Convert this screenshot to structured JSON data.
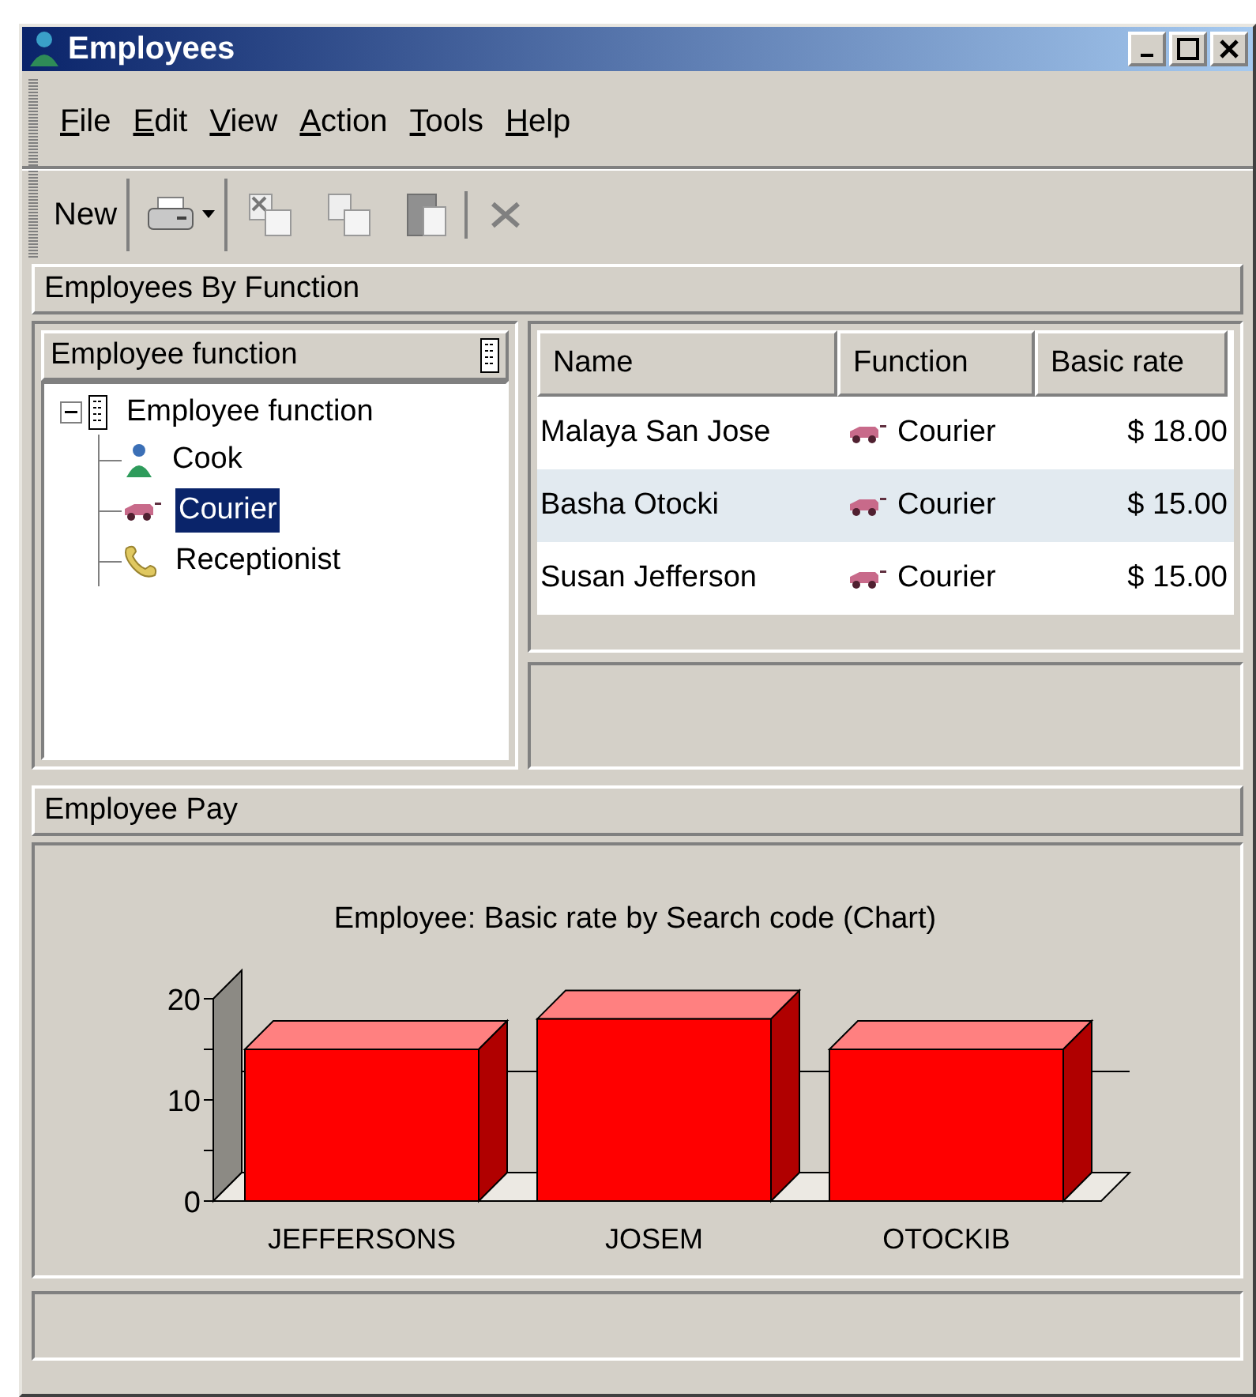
{
  "window": {
    "title": "Employees"
  },
  "menu": [
    {
      "label": "File"
    },
    {
      "label": "Edit"
    },
    {
      "label": "View"
    },
    {
      "label": "Action"
    },
    {
      "label": "Tools"
    },
    {
      "label": "Help"
    }
  ],
  "toolbar": {
    "new_label": "New"
  },
  "section_1": {
    "title": "Employees By Function",
    "tree": {
      "header": "Employee function",
      "root": {
        "label": "Employee function",
        "expanded": true,
        "children": [
          {
            "label": "Cook",
            "selected": false
          },
          {
            "label": "Courier",
            "selected": true
          },
          {
            "label": "Receptionist",
            "selected": false
          }
        ]
      }
    },
    "table": {
      "columns": [
        "Name",
        "Function",
        "Basic rate"
      ],
      "rows": [
        {
          "name": "Malaya San Jose",
          "function": "Courier",
          "rate": "$ 18.00",
          "selected": false
        },
        {
          "name": "Basha Otocki",
          "function": "Courier",
          "rate": "$ 15.00",
          "selected": true
        },
        {
          "name": "Susan Jefferson",
          "function": "Courier",
          "rate": "$ 15.00",
          "selected": false
        }
      ]
    }
  },
  "section_2": {
    "title": "Employee Pay",
    "chart_data": {
      "type": "bar",
      "title": "Employee: Basic rate by Search code (Chart)",
      "categories": [
        "JEFFERSONS",
        "JOSEM",
        "OTOCKIB"
      ],
      "series": [
        {
          "color": "#ff0000",
          "values": [
            15,
            18,
            15
          ]
        }
      ],
      "ylim": [
        0,
        20
      ],
      "yticks": [
        0,
        10,
        20
      ]
    }
  }
}
